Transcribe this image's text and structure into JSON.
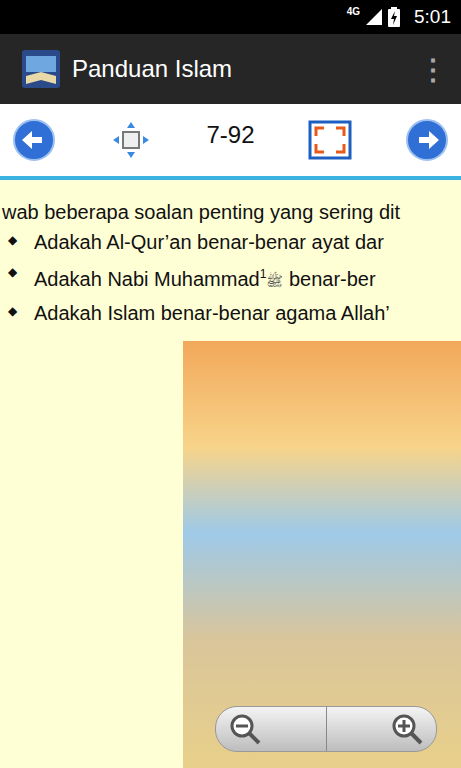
{
  "status_bar": {
    "network": "4G",
    "time": "5:01"
  },
  "app_bar": {
    "title": "Panduan Islam",
    "menu": "⋮"
  },
  "toolbar": {
    "page": "7-92"
  },
  "content": {
    "lead": "wab beberapa soalan penting yang sering dit",
    "bullet": "◆",
    "items": [
      {
        "text": "Adakah Al-Qur’an benar-benar ayat dar",
        "mark": "",
        "footnote": "",
        "rest": ""
      },
      {
        "text": "Adakah Nabi Muhammad",
        "mark": "ﷺ",
        "footnote": "1",
        "rest": "benar-ber"
      },
      {
        "text": "Adakah Islam benar-benar agama Allah’",
        "mark": "",
        "footnote": "",
        "rest": ""
      }
    ]
  }
}
